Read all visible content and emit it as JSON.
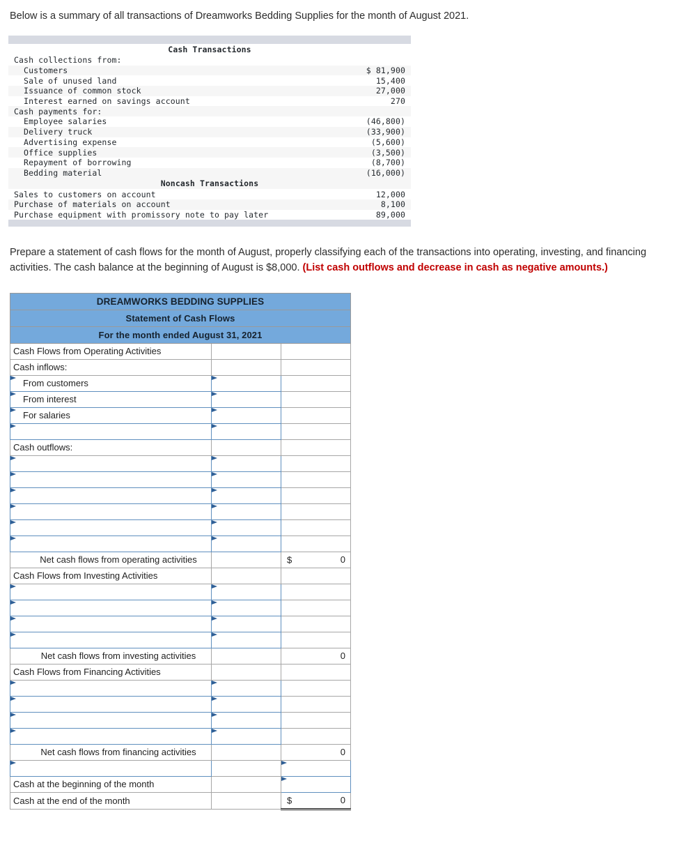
{
  "intro": "Below is a summary of all transactions of Dreamworks Bedding Supplies for the month of August 2021.",
  "instruction": {
    "part1": "Prepare a statement of cash flows for the month of August, properly classifying each of the transactions into operating, investing, and financing activities. The cash balance at the beginning of August is $8,000. ",
    "emphasis": "(List cash outflows and decrease in cash as negative amounts.)"
  },
  "transactions": {
    "cash_header": "Cash Transactions",
    "noncash_header": "Noncash Transactions",
    "cash_rows": [
      {
        "label": "Cash collections from:",
        "amount": ""
      },
      {
        "label": "  Customers",
        "amount": "$ 81,900"
      },
      {
        "label": "  Sale of unused land",
        "amount": "15,400"
      },
      {
        "label": "  Issuance of common stock",
        "amount": "27,000"
      },
      {
        "label": "  Interest earned on savings account",
        "amount": "270"
      },
      {
        "label": "Cash payments for:",
        "amount": ""
      },
      {
        "label": "  Employee salaries",
        "amount": "(46,800)"
      },
      {
        "label": "  Delivery truck",
        "amount": "(33,900)"
      },
      {
        "label": "  Advertising expense",
        "amount": "(5,600)"
      },
      {
        "label": "  Office supplies",
        "amount": "(3,500)"
      },
      {
        "label": "  Repayment of borrowing",
        "amount": "(8,700)"
      },
      {
        "label": "  Bedding material",
        "amount": "(16,000)"
      }
    ],
    "noncash_rows": [
      {
        "label": "Sales to customers on account",
        "amount": "12,000"
      },
      {
        "label": "Purchase of materials on account",
        "amount": "8,100"
      },
      {
        "label": "Purchase equipment with promissory note to pay later",
        "amount": "89,000"
      }
    ]
  },
  "statement": {
    "company": "DREAMWORKS BEDDING SUPPLIES",
    "title": "Statement of Cash Flows",
    "period": "For the month ended August 31, 2021",
    "operating_section_label": "Cash Flows from Operating Activities",
    "cash_inflows_label": "Cash inflows:",
    "inflow_rows": [
      {
        "label": "From customers",
        "mid": "",
        "right": ""
      },
      {
        "label": "From interest",
        "mid": "",
        "right": ""
      },
      {
        "label": "For salaries",
        "mid": "",
        "right": ""
      },
      {
        "label": "",
        "mid": "",
        "right": ""
      }
    ],
    "cash_outflows_label": "Cash outflows:",
    "outflow_rows": [
      {
        "label": "",
        "mid": "",
        "right": ""
      },
      {
        "label": "",
        "mid": "",
        "right": ""
      },
      {
        "label": "",
        "mid": "",
        "right": ""
      },
      {
        "label": "",
        "mid": "",
        "right": ""
      },
      {
        "label": "",
        "mid": "",
        "right": ""
      },
      {
        "label": "",
        "mid": "",
        "right": ""
      }
    ],
    "net_operating_label": "Net cash flows from operating activities",
    "net_operating_dollar": "$",
    "net_operating_value": "0",
    "investing_section_label": "Cash Flows from Investing Activities",
    "investing_rows": [
      {
        "label": "",
        "mid": "",
        "right": ""
      },
      {
        "label": "",
        "mid": "",
        "right": ""
      },
      {
        "label": "",
        "mid": "",
        "right": ""
      },
      {
        "label": "",
        "mid": "",
        "right": ""
      }
    ],
    "net_investing_label": "Net cash flows from investing activities",
    "net_investing_value": "0",
    "financing_section_label": "Cash Flows from Financing Activities",
    "financing_rows": [
      {
        "label": "",
        "mid": "",
        "right": ""
      },
      {
        "label": "",
        "mid": "",
        "right": ""
      },
      {
        "label": "",
        "mid": "",
        "right": ""
      },
      {
        "label": "",
        "mid": "",
        "right": ""
      }
    ],
    "net_financing_label": "Net cash flows from financing activities",
    "net_financing_value": "0",
    "net_change_label": "",
    "beginning_cash_label": "Cash at the beginning of the month",
    "ending_cash_label": "Cash at the end of the month",
    "ending_cash_dollar": "$",
    "ending_cash_value": "0"
  },
  "colors": {
    "header_blue": "#74a9dc",
    "input_border": "#5f8fbe",
    "flag": "#2f5f96",
    "emphasis_red": "#c00000",
    "txn_bar": "#d7dae2"
  }
}
